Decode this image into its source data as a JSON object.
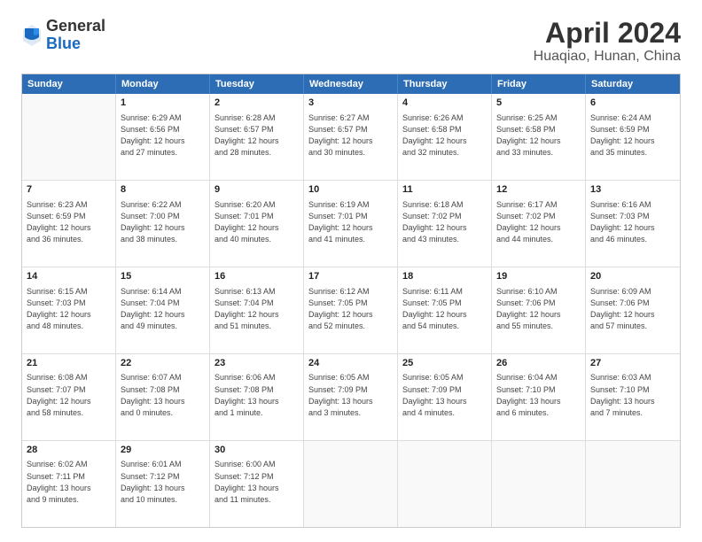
{
  "logo": {
    "general": "General",
    "blue": "Blue"
  },
  "title": "April 2024",
  "subtitle": "Huaqiao, Hunan, China",
  "header_days": [
    "Sunday",
    "Monday",
    "Tuesday",
    "Wednesday",
    "Thursday",
    "Friday",
    "Saturday"
  ],
  "weeks": [
    [
      {
        "day": "",
        "info": ""
      },
      {
        "day": "1",
        "info": "Sunrise: 6:29 AM\nSunset: 6:56 PM\nDaylight: 12 hours\nand 27 minutes."
      },
      {
        "day": "2",
        "info": "Sunrise: 6:28 AM\nSunset: 6:57 PM\nDaylight: 12 hours\nand 28 minutes."
      },
      {
        "day": "3",
        "info": "Sunrise: 6:27 AM\nSunset: 6:57 PM\nDaylight: 12 hours\nand 30 minutes."
      },
      {
        "day": "4",
        "info": "Sunrise: 6:26 AM\nSunset: 6:58 PM\nDaylight: 12 hours\nand 32 minutes."
      },
      {
        "day": "5",
        "info": "Sunrise: 6:25 AM\nSunset: 6:58 PM\nDaylight: 12 hours\nand 33 minutes."
      },
      {
        "day": "6",
        "info": "Sunrise: 6:24 AM\nSunset: 6:59 PM\nDaylight: 12 hours\nand 35 minutes."
      }
    ],
    [
      {
        "day": "7",
        "info": "Sunrise: 6:23 AM\nSunset: 6:59 PM\nDaylight: 12 hours\nand 36 minutes."
      },
      {
        "day": "8",
        "info": "Sunrise: 6:22 AM\nSunset: 7:00 PM\nDaylight: 12 hours\nand 38 minutes."
      },
      {
        "day": "9",
        "info": "Sunrise: 6:20 AM\nSunset: 7:01 PM\nDaylight: 12 hours\nand 40 minutes."
      },
      {
        "day": "10",
        "info": "Sunrise: 6:19 AM\nSunset: 7:01 PM\nDaylight: 12 hours\nand 41 minutes."
      },
      {
        "day": "11",
        "info": "Sunrise: 6:18 AM\nSunset: 7:02 PM\nDaylight: 12 hours\nand 43 minutes."
      },
      {
        "day": "12",
        "info": "Sunrise: 6:17 AM\nSunset: 7:02 PM\nDaylight: 12 hours\nand 44 minutes."
      },
      {
        "day": "13",
        "info": "Sunrise: 6:16 AM\nSunset: 7:03 PM\nDaylight: 12 hours\nand 46 minutes."
      }
    ],
    [
      {
        "day": "14",
        "info": "Sunrise: 6:15 AM\nSunset: 7:03 PM\nDaylight: 12 hours\nand 48 minutes."
      },
      {
        "day": "15",
        "info": "Sunrise: 6:14 AM\nSunset: 7:04 PM\nDaylight: 12 hours\nand 49 minutes."
      },
      {
        "day": "16",
        "info": "Sunrise: 6:13 AM\nSunset: 7:04 PM\nDaylight: 12 hours\nand 51 minutes."
      },
      {
        "day": "17",
        "info": "Sunrise: 6:12 AM\nSunset: 7:05 PM\nDaylight: 12 hours\nand 52 minutes."
      },
      {
        "day": "18",
        "info": "Sunrise: 6:11 AM\nSunset: 7:05 PM\nDaylight: 12 hours\nand 54 minutes."
      },
      {
        "day": "19",
        "info": "Sunrise: 6:10 AM\nSunset: 7:06 PM\nDaylight: 12 hours\nand 55 minutes."
      },
      {
        "day": "20",
        "info": "Sunrise: 6:09 AM\nSunset: 7:06 PM\nDaylight: 12 hours\nand 57 minutes."
      }
    ],
    [
      {
        "day": "21",
        "info": "Sunrise: 6:08 AM\nSunset: 7:07 PM\nDaylight: 12 hours\nand 58 minutes."
      },
      {
        "day": "22",
        "info": "Sunrise: 6:07 AM\nSunset: 7:08 PM\nDaylight: 13 hours\nand 0 minutes."
      },
      {
        "day": "23",
        "info": "Sunrise: 6:06 AM\nSunset: 7:08 PM\nDaylight: 13 hours\nand 1 minute."
      },
      {
        "day": "24",
        "info": "Sunrise: 6:05 AM\nSunset: 7:09 PM\nDaylight: 13 hours\nand 3 minutes."
      },
      {
        "day": "25",
        "info": "Sunrise: 6:05 AM\nSunset: 7:09 PM\nDaylight: 13 hours\nand 4 minutes."
      },
      {
        "day": "26",
        "info": "Sunrise: 6:04 AM\nSunset: 7:10 PM\nDaylight: 13 hours\nand 6 minutes."
      },
      {
        "day": "27",
        "info": "Sunrise: 6:03 AM\nSunset: 7:10 PM\nDaylight: 13 hours\nand 7 minutes."
      }
    ],
    [
      {
        "day": "28",
        "info": "Sunrise: 6:02 AM\nSunset: 7:11 PM\nDaylight: 13 hours\nand 9 minutes."
      },
      {
        "day": "29",
        "info": "Sunrise: 6:01 AM\nSunset: 7:12 PM\nDaylight: 13 hours\nand 10 minutes."
      },
      {
        "day": "30",
        "info": "Sunrise: 6:00 AM\nSunset: 7:12 PM\nDaylight: 13 hours\nand 11 minutes."
      },
      {
        "day": "",
        "info": ""
      },
      {
        "day": "",
        "info": ""
      },
      {
        "day": "",
        "info": ""
      },
      {
        "day": "",
        "info": ""
      }
    ]
  ]
}
